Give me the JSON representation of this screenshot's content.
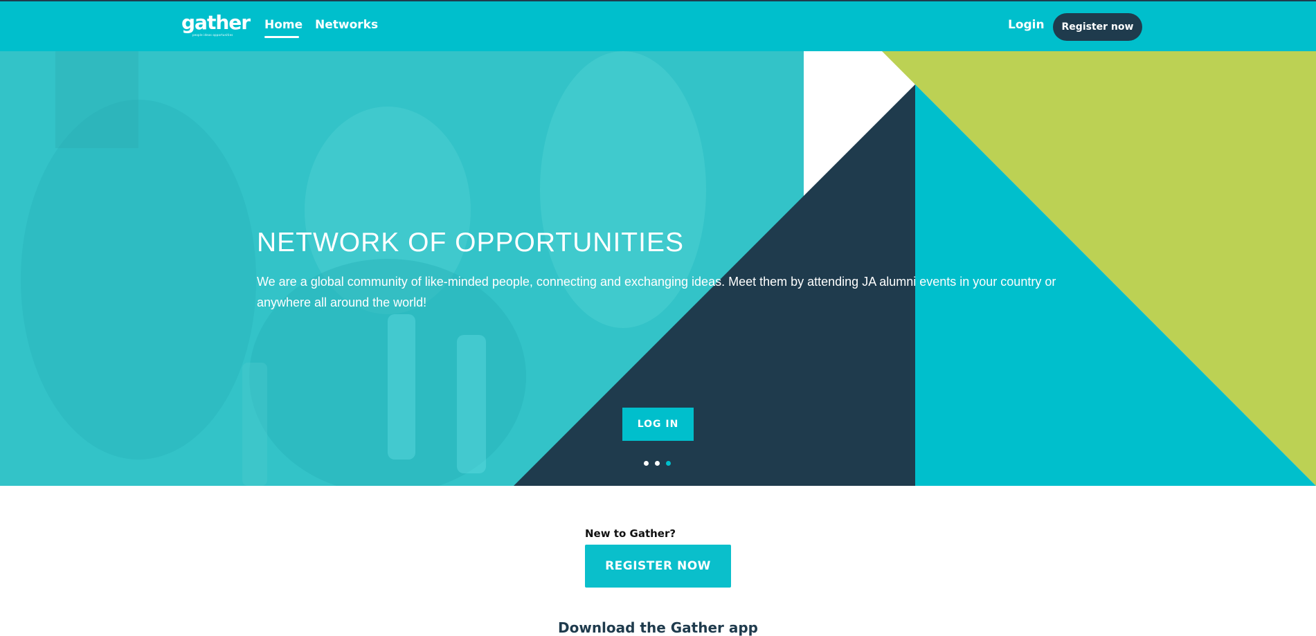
{
  "header": {
    "logo_text": "gather",
    "logo_tagline": "people ideas opportunities",
    "nav": {
      "home": "Home",
      "networks": "Networks"
    },
    "login": "Login",
    "register": "Register now"
  },
  "hero": {
    "title": "NETWORK OF OPPORTUNITIES",
    "text": "We are a global community of like-minded people, connecting and exchanging ideas. Meet them by attending JA alumni events in your country or anywhere all around the world!",
    "login_button": "LOG IN",
    "slides_total": 3,
    "active_slide": 3
  },
  "signup": {
    "new_label": "New to Gather?",
    "register_button": "REGISTER NOW"
  },
  "download": {
    "title": "Download the Gather app"
  },
  "colors": {
    "brand_teal": "#00bfcc",
    "navy": "#1f3b4d",
    "lime": "#bcd154",
    "white": "#ffffff"
  }
}
